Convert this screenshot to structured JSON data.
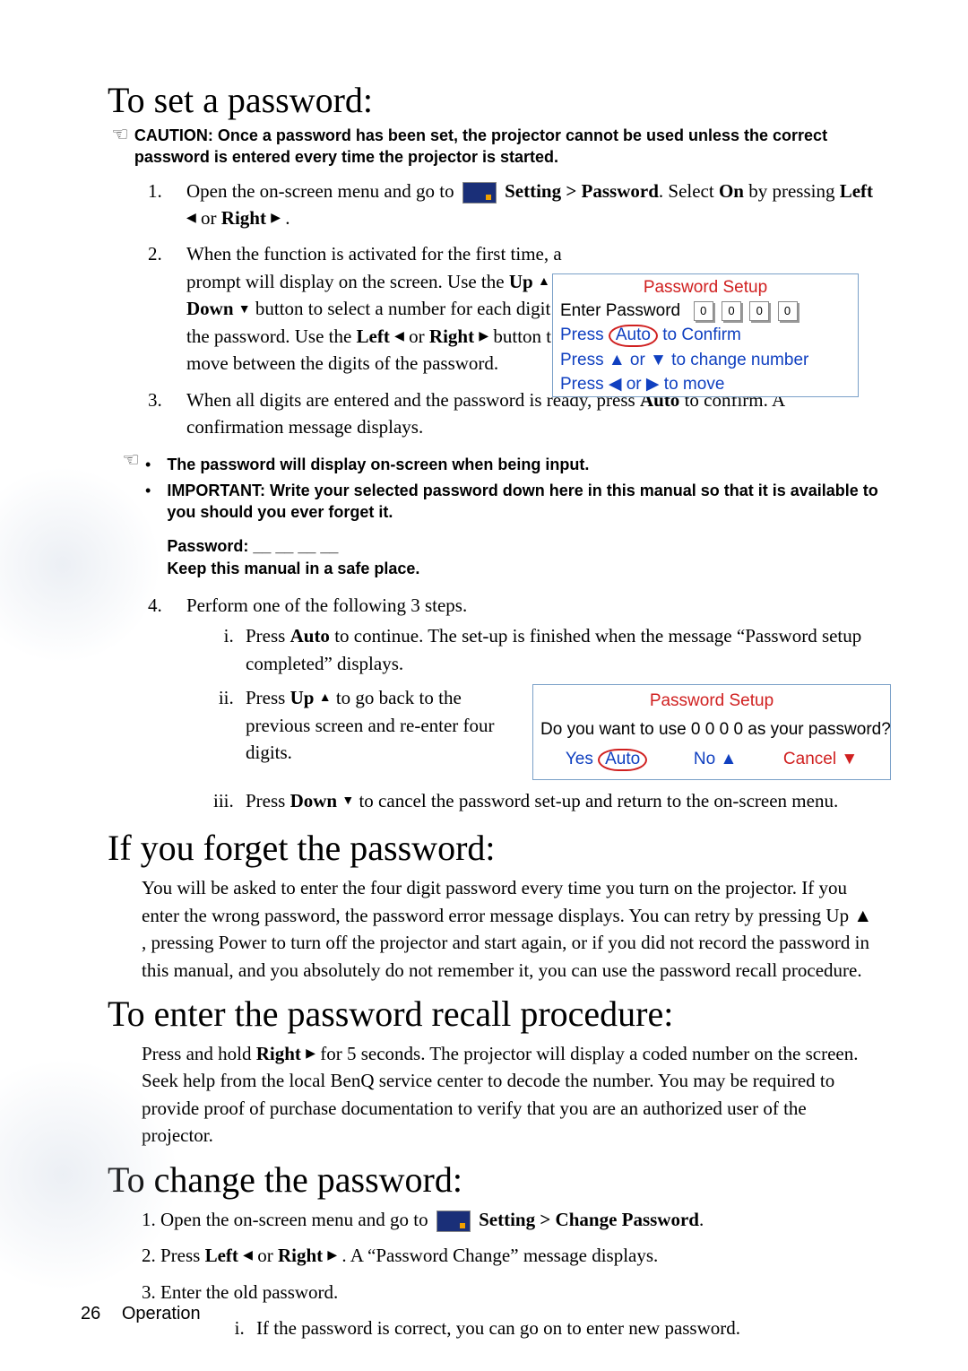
{
  "headings": {
    "set": "To set a password:",
    "forget": "If you forget the password:",
    "recall": "To enter the password recall procedure:",
    "change": "To change the password:"
  },
  "caution": "CAUTION: Once a password has been set, the projector cannot be used unless the correct password is entered every time the projector is started.",
  "steps": {
    "s1a": "Open the on-screen menu and go to ",
    "s1b": " Setting > Password",
    "s1c": ". Select ",
    "s1d": "On",
    "s1e": " by pressing ",
    "s1f": "Left",
    "s1g": " or ",
    "s1h": "Right",
    "s1i": " .",
    "s2a": "When the function is activated for the first time, a prompt will display on the screen. Use the ",
    "s2b": "Up",
    "s2c": " or ",
    "s2d": "Down",
    "s2e": " button to select a number for each digit of the password. Use the ",
    "s2f": "Left",
    "s2g": " or ",
    "s2h": "Right",
    "s2i": " button to move between the digits of the password.",
    "s3": "When all digits are entered and the password is ready, press ",
    "s3b": "Auto",
    "s3c": " to confirm. A confirmation message displays.",
    "s4": "Perform one of the following 3 steps.",
    "r1a": "Press ",
    "r1b": "Auto",
    "r1c": " to continue. The set-up is finished when the message “Password setup completed” displays.",
    "r2a": "Press ",
    "r2b": "Up",
    "r2c": " to go back to the previous screen and re-enter four digits.",
    "r3a": "Press ",
    "r3b": "Down",
    "r3c": " to cancel the password set-up and return to the on-screen menu."
  },
  "notes": {
    "n1": "The password will display on-screen when being input.",
    "n2": "IMPORTANT: Write your selected password down here in this manual so that it is available to you should you ever forget it.",
    "n3": "Password: __ __ __ __",
    "n4": "Keep this manual in a safe place."
  },
  "forget_para": "You will be asked to enter the four digit password every time you turn on the projector. If you enter the wrong password, the password error message displays. You can retry by pressing Up ▲ , pressing Power to turn off the projector and start again, or if you did not record the password in this manual, and you absolutely do not remember it, you can use the password recall procedure.",
  "recall_para_a": "Press and hold ",
  "recall_para_b": "Right",
  "recall_para_c": " for 5 seconds. The projector will display a coded number on the screen. Seek help from the local BenQ service center to decode the number. You may be required to provide proof of purchase documentation to verify that you are an authorized user of the projector.",
  "change": {
    "c1a": "1. Open the on-screen menu and go to ",
    "c1b": " Setting > Change Password",
    "c1c": ".",
    "c2a": "2. Press ",
    "c2b": "Left",
    "c2c": " or ",
    "c2d": "Right",
    "c2e": " . A “Password Change” message displays.",
    "c3": "3. Enter the old password.",
    "c3i": "If the password is correct, you can go on to enter new password."
  },
  "osd1": {
    "title": "Password Setup",
    "enter": "Enter Password",
    "d": "0",
    "confirm_a": "Press",
    "confirm_b": "Auto",
    "confirm_c": " to Confirm",
    "chg": "Press ▲ or ▼ to change number",
    "mov": "Press ◀ or ▶ to move"
  },
  "osd2": {
    "title": "Password Setup",
    "q": "Do you want to use 0 0 0 0 as your password?",
    "yes": "Yes ",
    "auto": "Auto",
    "no": "No ▲",
    "cancel": "Cancel ▼"
  },
  "footer": {
    "page": "26",
    "section": "Operation"
  },
  "glyph": {
    "left": "◀",
    "right": "▶",
    "up": "▲",
    "down": "▼"
  }
}
